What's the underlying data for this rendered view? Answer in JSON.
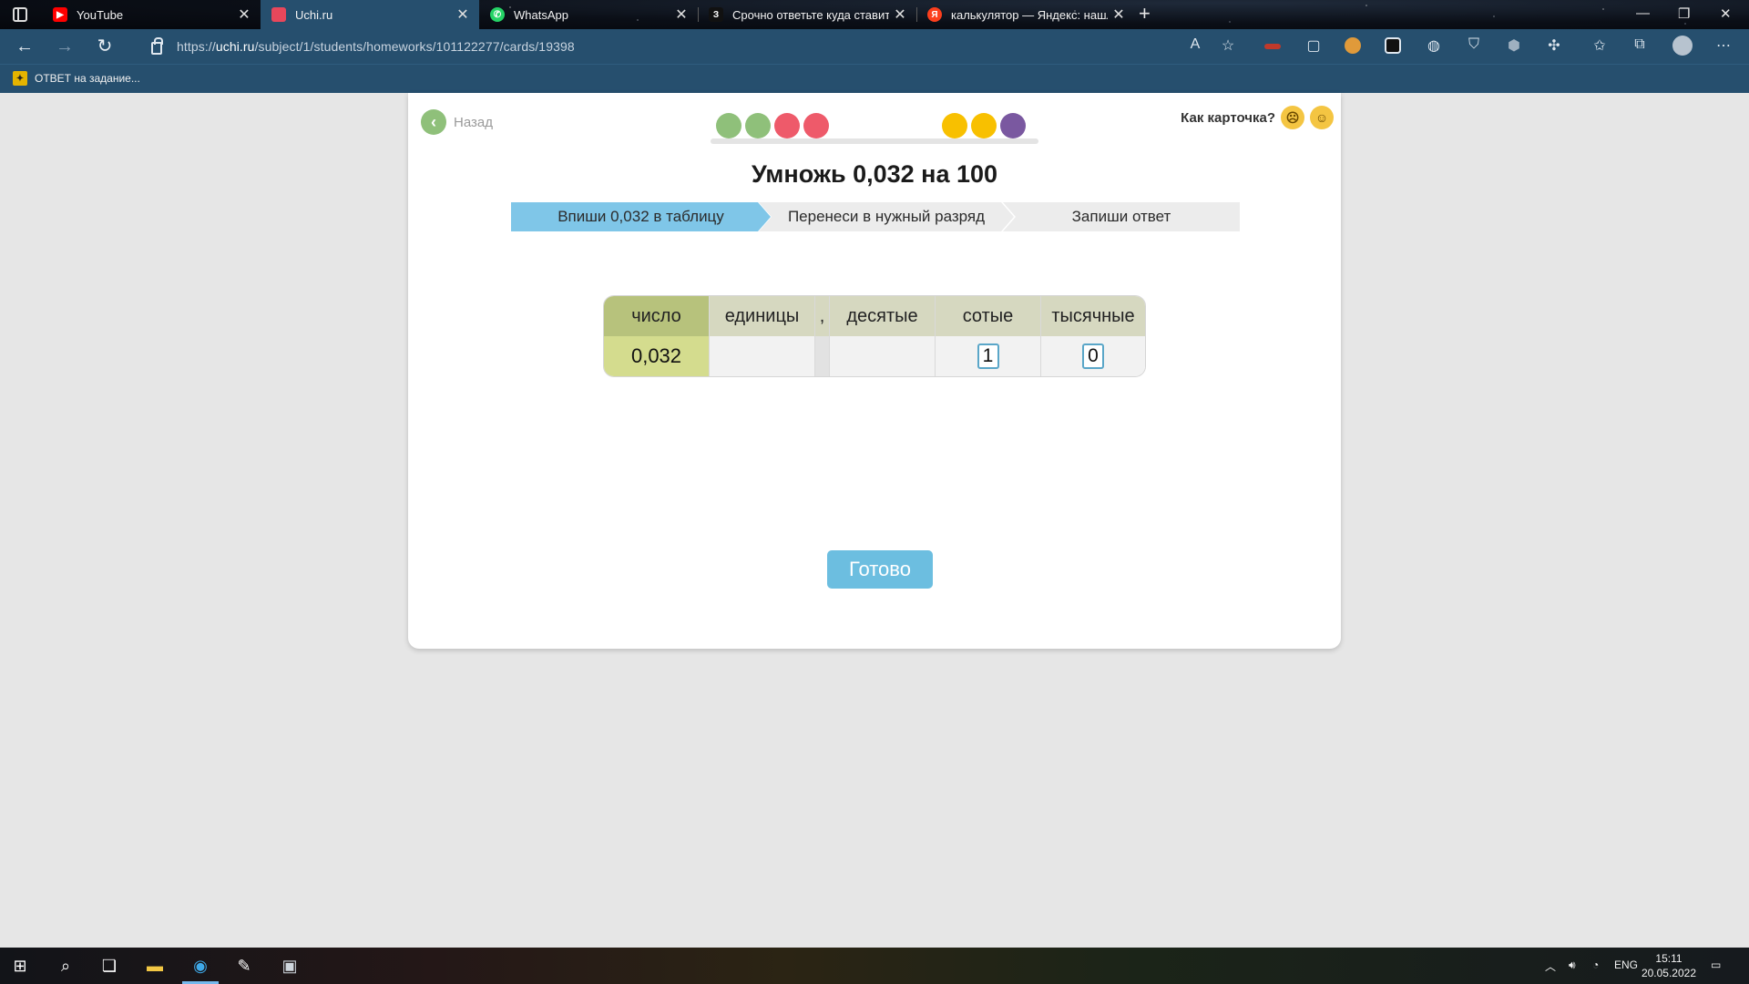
{
  "browser": {
    "tabs": [
      {
        "title": "YouTube",
        "active": false,
        "favicon": "youtube-icon",
        "color": "#ff0000"
      },
      {
        "title": "Uchi.ru",
        "active": true,
        "favicon": "uchi-icon",
        "color": "#e8475b"
      },
      {
        "title": "WhatsApp",
        "active": false,
        "favicon": "whatsapp-icon",
        "color": "#25d366"
      },
      {
        "title": "Срочно ответьте куда ставить",
        "active": false,
        "favicon": "znanija-icon",
        "color": "#111111",
        "fav_text": "З"
      },
      {
        "title": "калькулятор — Яндекс: нашлос",
        "active": false,
        "favicon": "yandex-icon",
        "color": "#fc3f1d",
        "fav_text": "Я"
      }
    ],
    "url_prefix": "https://",
    "url_host": "uchi.ru",
    "url_path": "/subject/1/students/homeworks/101122277/cards/19398",
    "bookmark": "ОТВЕТ на задание..."
  },
  "page": {
    "back_label": "Назад",
    "rating_question": "Как карточка?",
    "title": "Умножь 0,032 на 100",
    "steps": [
      "Впиши 0,032 в таблицу",
      "Перенеси в нужный разряд",
      "Запиши ответ"
    ],
    "progress_dots": [
      "#8fc07a",
      "#8fc07a",
      "#ee5a6a",
      "#ee5a6a",
      "empty",
      "empty",
      "empty",
      "empty",
      "#f8c000",
      "#f8c000",
      "#7a58a0"
    ],
    "table": {
      "headers": [
        "число",
        "единицы",
        ",",
        "десятые",
        "сотые",
        "тысячные"
      ],
      "number": "0,032",
      "units": "",
      "comma": "",
      "tenths": "",
      "hundredths": "1",
      "thousandths": "0"
    },
    "done_label": "Готово"
  },
  "taskbar": {
    "lang": "ENG",
    "time": "15:11",
    "date": "20.05.2022"
  }
}
